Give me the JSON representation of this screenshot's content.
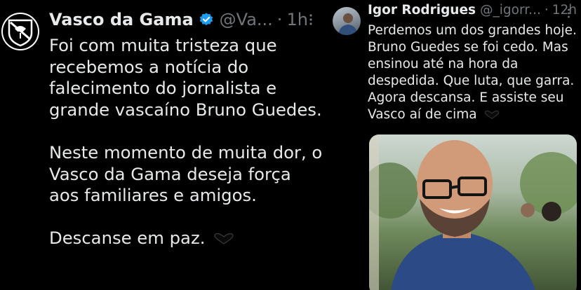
{
  "left_tweet": {
    "display_name": "Vasco da Gama",
    "handle": "@Va...",
    "separator": "·",
    "time": "1h",
    "paragraphs": [
      [
        "Foi com muita tristeza que",
        "recebemos a notícia do",
        "falecimento do jornalista e",
        "grande vascaíno Bruno Guedes."
      ],
      [
        "Neste momento de muita dor, o",
        "Vasco da Gama deseja força",
        "aos familiares e amigos."
      ],
      [
        "Descanse em paz."
      ]
    ],
    "verified_color": "#1d9bf0"
  },
  "right_tweet": {
    "display_name": "Igor Rodrigues",
    "handle": "@_igorr...",
    "separator": "·",
    "time": "12h",
    "lines": [
      "Perdemos um dos grandes hoje.",
      "Bruno Guedes se foi cedo. Mas",
      "ensinou até na hora da",
      "despedida. Que luta, que garra.",
      "Agora descansa. E assiste seu",
      "Vasco aí de cima"
    ]
  },
  "icons": {
    "verified": "verified-badge-icon",
    "more": "more-options-icon",
    "heart": "black-heart-icon"
  },
  "colors": {
    "background": "#000000",
    "text": "#e7e9ea",
    "muted": "#71767b"
  }
}
